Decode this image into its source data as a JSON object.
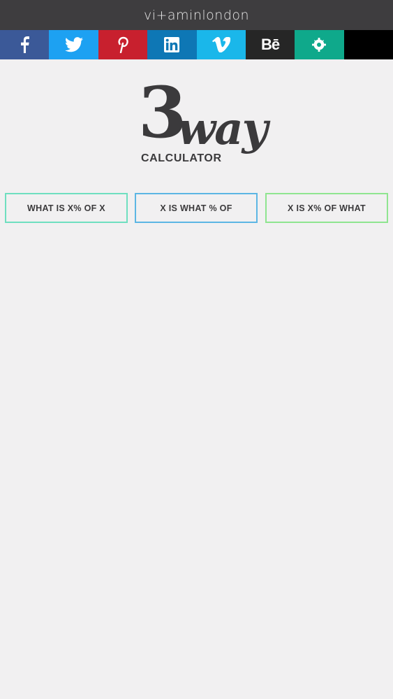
{
  "header": {
    "title": "vi+aminlondon"
  },
  "social": [
    {
      "name": "facebook",
      "icon": "facebook-icon",
      "color": "#3b5998"
    },
    {
      "name": "twitter",
      "icon": "twitter-icon",
      "color": "#1da1f2"
    },
    {
      "name": "pinterest",
      "icon": "pinterest-icon",
      "color": "#c8202e"
    },
    {
      "name": "linkedin",
      "icon": "linkedin-icon",
      "color": "#0e77b5"
    },
    {
      "name": "vimeo",
      "icon": "vimeo-icon",
      "color": "#1ab7ea"
    },
    {
      "name": "behance",
      "icon": "behance-icon",
      "label": "Bē",
      "color": "#262626"
    },
    {
      "name": "github-ish",
      "icon": "octocat-icon",
      "color": "#0fa98b"
    },
    {
      "name": "blank",
      "icon": "",
      "color": "#000000"
    }
  ],
  "logo": {
    "number": "3",
    "word": "way",
    "subtitle": "CALCULATOR"
  },
  "buttons": {
    "b1": "WHAT IS X% OF X",
    "b2": "X IS WHAT % OF",
    "b3": "X IS X% OF WHAT"
  },
  "colors": {
    "topbar": "#3e3d3f",
    "background": "#f1f0f1",
    "btn1_border": "#6fdfc0",
    "btn2_border": "#5cb6e4",
    "btn3_border": "#8fe590"
  }
}
